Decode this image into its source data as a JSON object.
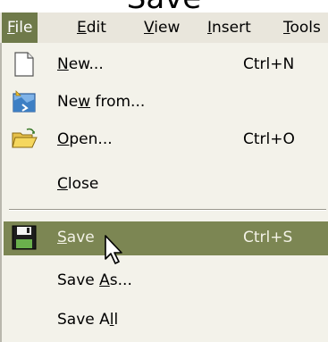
{
  "heading_fragment": "Save",
  "menubar": {
    "items": [
      {
        "label": "File",
        "accel": "F",
        "rest": "ile",
        "active": true
      },
      {
        "label": "Edit",
        "accel": "E",
        "rest": "dit"
      },
      {
        "label": "View",
        "accel": "V",
        "rest": "iew"
      },
      {
        "label": "Insert",
        "accel": "I",
        "rest": "nsert"
      },
      {
        "label": "Tools",
        "accel": "T",
        "rest": "ools"
      }
    ]
  },
  "file_menu": {
    "items": [
      {
        "label": "New...",
        "pre": "",
        "accel": "N",
        "post": "ew...",
        "shortcut": "Ctrl+N",
        "icon": "new-document-icon"
      },
      {
        "label": "New from...",
        "pre": "Ne",
        "accel": "w",
        "post": " from...",
        "shortcut": "",
        "icon": "new-from-icon"
      },
      {
        "label": "Open...",
        "pre": "",
        "accel": "O",
        "post": "pen...",
        "shortcut": "Ctrl+O",
        "icon": "open-folder-icon"
      },
      {
        "label": "Close",
        "pre": "",
        "accel": "C",
        "post": "lose",
        "shortcut": ""
      },
      {
        "label": "Save",
        "pre": "",
        "accel": "S",
        "post": "ave",
        "shortcut": "Ctrl+S",
        "icon": "save-disk-icon",
        "highlighted": true
      },
      {
        "label": "Save As...",
        "pre": "Save ",
        "accel": "A",
        "post": "s...",
        "shortcut": ""
      },
      {
        "label": "Save All",
        "pre": "Save A",
        "accel": "l",
        "post": "l",
        "shortcut": ""
      }
    ]
  },
  "colors": {
    "menubar_bg": "#e9e6dc",
    "menu_bg": "#f3f2ea",
    "highlight": "#7c8653",
    "active_menubar": "#6f7a4a"
  },
  "cursor_icon": "mouse-pointer-icon"
}
